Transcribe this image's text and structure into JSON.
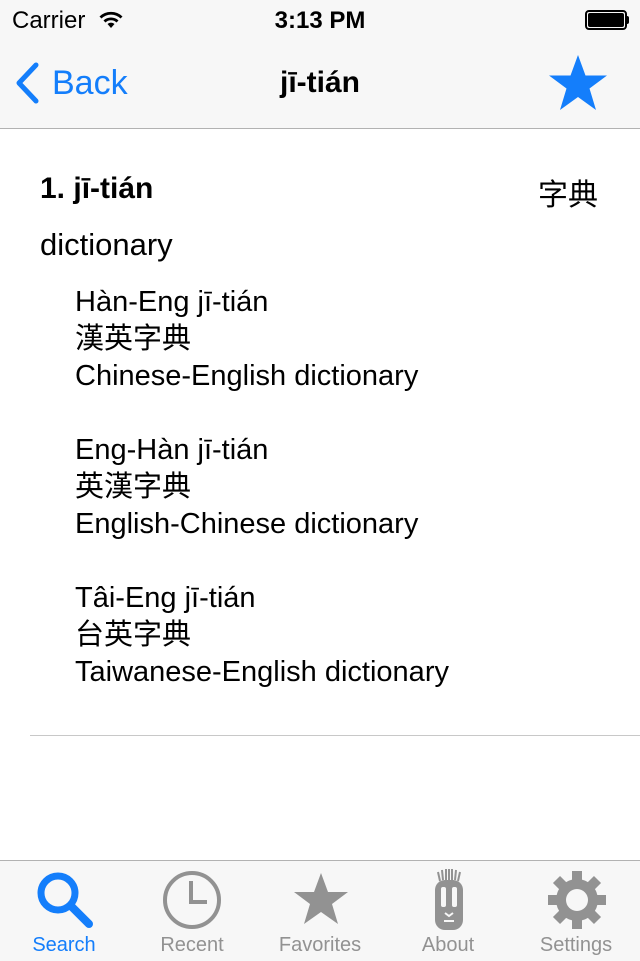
{
  "status_bar": {
    "carrier": "Carrier",
    "time": "3:13 PM",
    "wifi_icon": "wifi-icon",
    "battery_icon": "battery-full-icon"
  },
  "nav": {
    "back_label": "Back",
    "title": "jī-tián",
    "favorite_icon": "star-icon"
  },
  "colors": {
    "accent": "#147efb",
    "inactive": "#929292",
    "bar_bg": "#f7f7f7"
  },
  "entry": {
    "heading": "1. jī-tián",
    "hanzi": "字典",
    "definition": "dictionary",
    "examples": [
      {
        "romanization": "Hàn-Eng jī-tián",
        "hanzi": "漢英字典",
        "translation": "Chinese-English dictionary"
      },
      {
        "romanization": "Eng-Hàn jī-tián",
        "hanzi": "英漢字典",
        "translation": "English-Chinese dictionary"
      },
      {
        "romanization": "Tâi-Eng jī-tián",
        "hanzi": "台英字典",
        "translation": "Taiwanese-English dictionary"
      }
    ]
  },
  "tabs": [
    {
      "label": "Search",
      "icon": "search-icon",
      "active": true
    },
    {
      "label": "Recent",
      "icon": "clock-icon",
      "active": false
    },
    {
      "label": "Favorites",
      "icon": "star-icon",
      "active": false
    },
    {
      "label": "About",
      "icon": "tiki-mask-icon",
      "active": false
    },
    {
      "label": "Settings",
      "icon": "gear-icon",
      "active": false
    }
  ]
}
